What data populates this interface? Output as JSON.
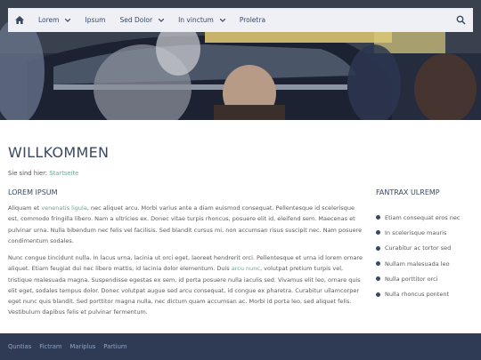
{
  "nav": {
    "items": [
      {
        "label": "Lorem",
        "dropdown": true
      },
      {
        "label": "Ipsum",
        "dropdown": false
      },
      {
        "label": "Sed Dolor",
        "dropdown": true
      },
      {
        "label": "In vinctum",
        "dropdown": true
      },
      {
        "label": "Proletra",
        "dropdown": false
      }
    ],
    "home_icon": "home-icon",
    "search_icon": "search-icon"
  },
  "page": {
    "title": "WILLKOMMEN",
    "breadcrumb_prefix": "Sie sind hier:",
    "breadcrumb_link": "Startseite"
  },
  "main": {
    "heading": "LOREM IPSUM",
    "p1": {
      "before": "Aliquam et ",
      "link": "venenatis ligula",
      "after": ", nec aliquet arcu. Morbi varius ante a diam euismod consequat. Pellentesque id scelerisque est, commodo fringilla libero. Nam a ultricies ex. Donec vitae turpis rhoncus, posuere elit id, eleifend sem. Maecenas et pulvinar urna. Nulla bibendum nec felis vel facilisis. Sed blandit cursus mi, non accumsan risus suscipit nec. Nam posuere condimentum sodales."
    },
    "p2": {
      "before": "Nunc congue tincidunt nulla. In lacus urna, lacinia ut orci eget, laoreet hendrerit orci. Pellentesque et urna id lorem ornare aliquet. Etiam feugiat dui nec libero mattis, id lacinia dolor elementum. Duis ",
      "link": "arcu nunc",
      "after": ", volutpat pretium turpis vel, tristique malesuada magna. Suspendisse egestas ex sem, id porta posuere nulla iaculis sed. Vivamus elit leo, ornare quis elit eget, sodales tempus dolor. Donec volutpat augue sed arcu consequat, id congue ex pharetra. Curabitur ullamcorper eget nunc quis blandit. Sed porttitor magna nulla, nec dictum quam accumsan ac. Morbi id porta leo, sed aliquet felis. Vestibulum dapibus felis et pulvinar fermentum."
    }
  },
  "sidebar": {
    "heading": "FANTRAX ULREMP",
    "items": [
      "Etiam consequat eros nec",
      "In scelerisque mauris",
      "Curabitur ac tortor sed",
      "Nullam malesuada leo",
      "Nulla porttitor orci",
      "Nulla rhoncus pontent"
    ]
  },
  "footer": {
    "links": [
      "Quntias",
      "Fictram",
      "Mariplus",
      "Partium"
    ]
  },
  "colors": {
    "accent": "#3b4863",
    "link": "#6ea59a",
    "footer_bg": "#2f3a55",
    "nav_bg": "#eef0f5"
  }
}
